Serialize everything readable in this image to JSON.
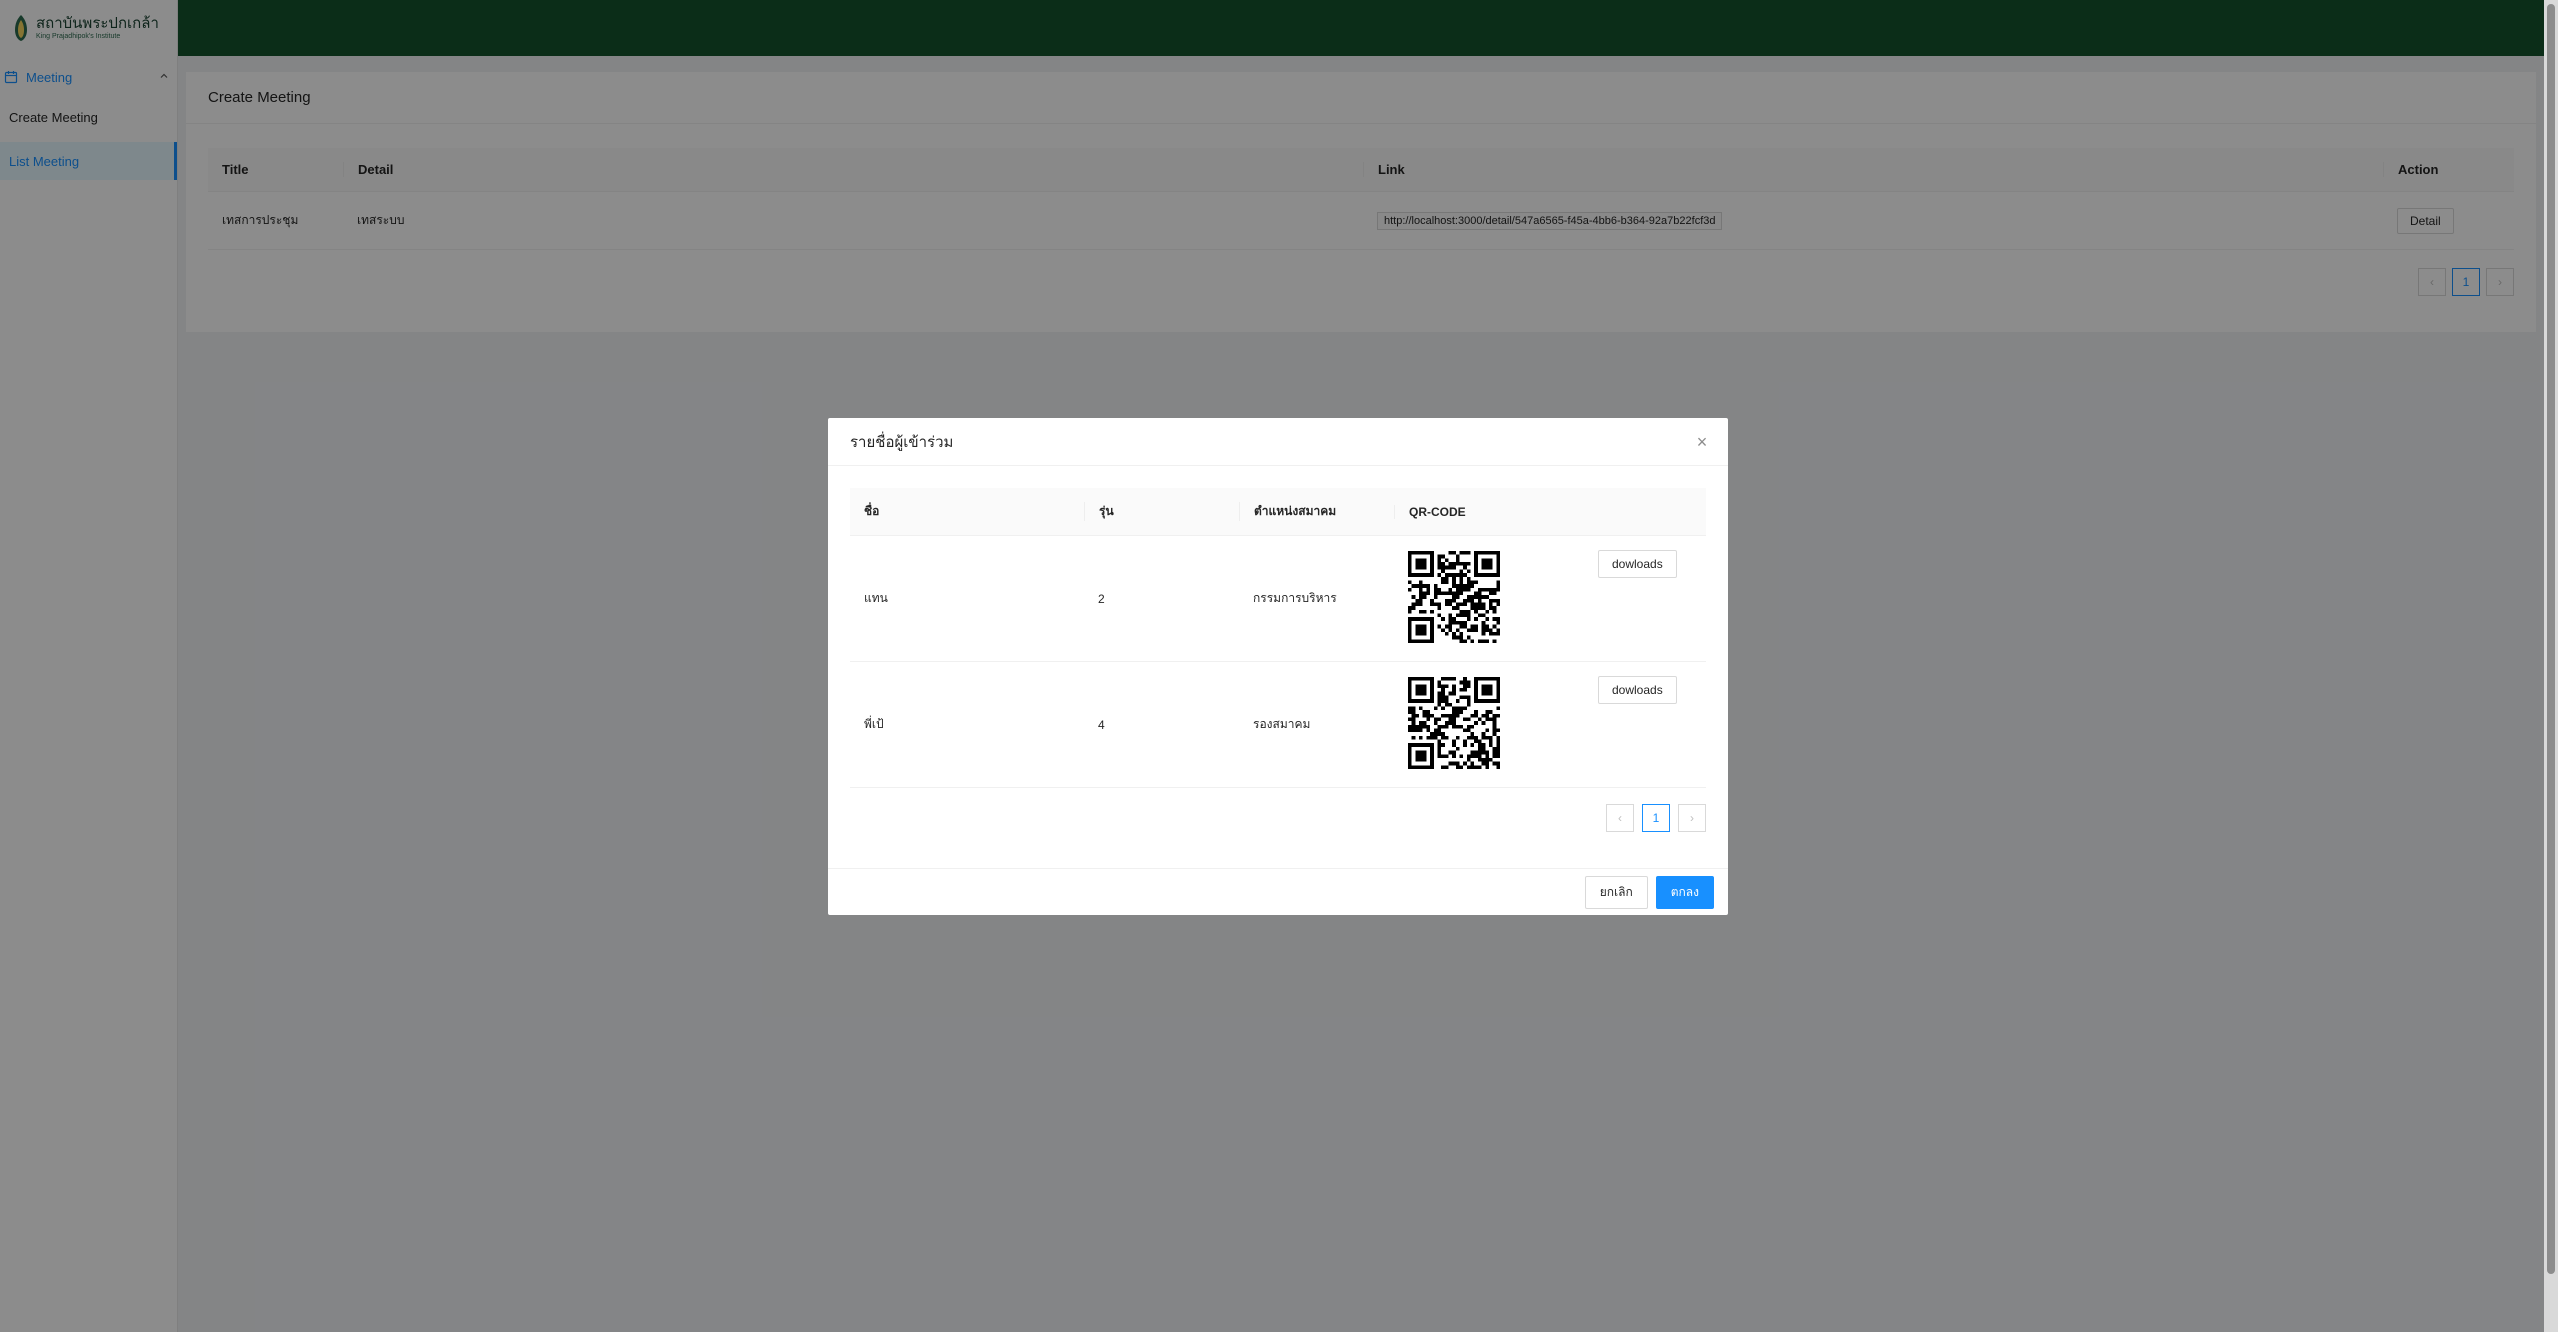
{
  "brand": {
    "name_th": "สถาบันพระปกเกล้า",
    "name_en": "King Prajadhipok's Institute",
    "header_color": "#14532d"
  },
  "sidebar": {
    "group_label": "Meeting",
    "items": [
      {
        "label": "Create Meeting",
        "active": false
      },
      {
        "label": "List Meeting",
        "active": true
      }
    ]
  },
  "page": {
    "card_title": "Create Meeting",
    "table": {
      "columns": [
        "Title",
        "Detail",
        "Link",
        "Action"
      ],
      "rows": [
        {
          "title": "เทสการประชุม",
          "detail": "เทสระบบ",
          "link": "http://localhost:3000/detail/547a6565-f45a-4bb6-b364-92a7b22fcf3d",
          "action": "Detail"
        }
      ]
    },
    "pagination": {
      "prev": "‹",
      "current": "1",
      "next": "›"
    }
  },
  "modal": {
    "title": "รายชื่อผู้เข้าร่วม",
    "close_icon": "×",
    "columns": [
      "ชื่อ",
      "รุ่น",
      "ตำแหน่งสมาคม",
      "QR-CODE"
    ],
    "rows": [
      {
        "name": "แทน",
        "generation": "2",
        "position": "กรรมการบริหาร",
        "download_label": "dowloads"
      },
      {
        "name": "พี่เป้",
        "generation": "4",
        "position": "รองสมาคม",
        "download_label": "dowloads"
      }
    ],
    "pagination": {
      "prev": "‹",
      "current": "1",
      "next": "›"
    },
    "cancel_label": "ยกเลิก",
    "ok_label": "ตกลง",
    "accent_color": "#1890ff"
  }
}
